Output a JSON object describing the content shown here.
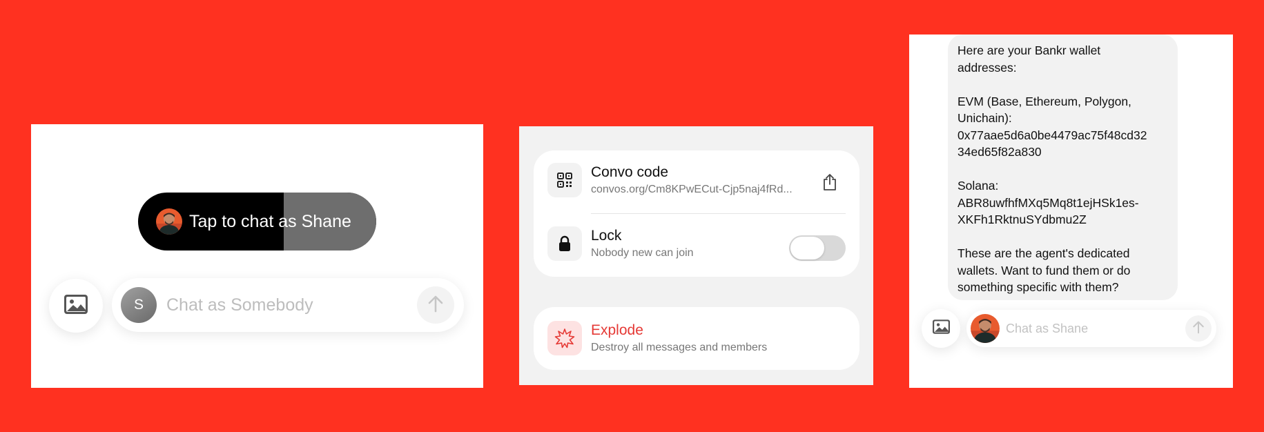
{
  "colors": {
    "background": "#ff3120",
    "explode_red": "#e53935"
  },
  "panel_left": {
    "tap_to_chat_label": "Tap to chat as Shane",
    "photo_icon": "photo-icon",
    "input_avatar_initial": "S",
    "input_placeholder": "Chat as Somebody",
    "send_icon": "arrow-up-icon"
  },
  "panel_middle": {
    "convo_code": {
      "title": "Convo code",
      "subtitle": "convos.org/Cm8KPwECut-Cjp5naj4fRd...",
      "icon": "qr-code-icon",
      "action_icon": "share-icon"
    },
    "lock": {
      "title": "Lock",
      "subtitle": "Nobody new can join",
      "icon": "lock-icon",
      "toggle_on": false
    },
    "explode": {
      "title": "Explode",
      "subtitle": "Destroy all messages and members",
      "icon": "explosion-icon"
    }
  },
  "panel_right": {
    "message_lines": [
      "Here are your Bankr wallet",
      "addresses:",
      "",
      "EVM (Base, Ethereum, Polygon,",
      "Unichain):",
      "0x77aae5d6a0be4479ac75f48cd32",
      "34ed65f82a830",
      "",
      "Solana:",
      "ABR8uwfhfMXq5Mq8t1ejHSk1es-",
      "XKFh1RktnuSYdbmu2Z",
      "",
      "These are the agent's dedicated",
      "wallets. Want to fund them or do",
      "something specific with them?"
    ],
    "input_placeholder": "Chat as Shane",
    "photo_icon": "photo-icon",
    "send_icon": "arrow-up-icon"
  }
}
